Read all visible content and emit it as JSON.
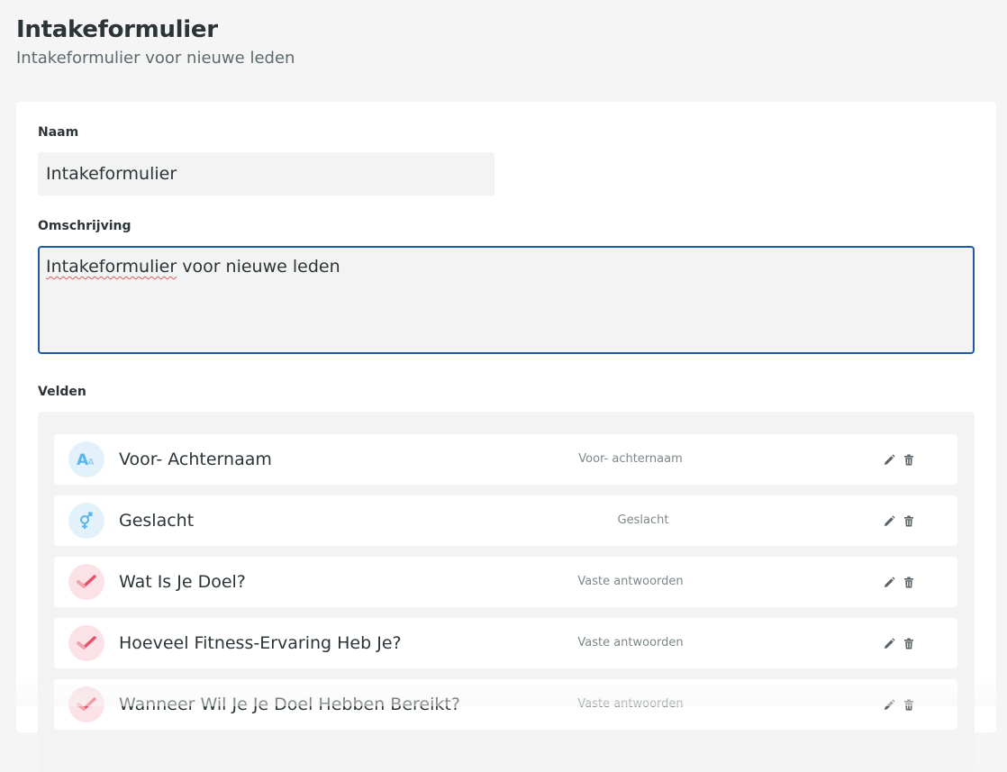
{
  "header": {
    "title": "Intakeformulier",
    "subtitle": "Intakeformulier voor nieuwe leden"
  },
  "form": {
    "name_label": "Naam",
    "name_value": "Intakeformulier",
    "description_label": "Omschrijving",
    "description_value_misspelled": "Intakeformulier",
    "description_value_rest": " voor nieuwe leden",
    "fields_label": "Velden"
  },
  "fields": [
    {
      "title": "Voor- Achternaam",
      "type": "Voor- achternaam",
      "icon": "text-size-icon"
    },
    {
      "title": "Geslacht",
      "type": "Geslacht",
      "icon": "gender-icon"
    },
    {
      "title": "Wat Is Je Doel?",
      "type": "Vaste antwoorden",
      "icon": "checkmark-icon"
    },
    {
      "title": "Hoeveel Fitness-Ervaring Heb Je?",
      "type": "Vaste antwoorden",
      "icon": "checkmark-icon"
    },
    {
      "title": "Wanneer Wil Je Je Doel Hebben Bereikt?",
      "type": "Vaste antwoorden",
      "icon": "checkmark-icon"
    }
  ],
  "colors": {
    "accent_border": "#1d5aa8",
    "icon_blue": "#5bb5e8",
    "icon_red": "#e8536a"
  }
}
